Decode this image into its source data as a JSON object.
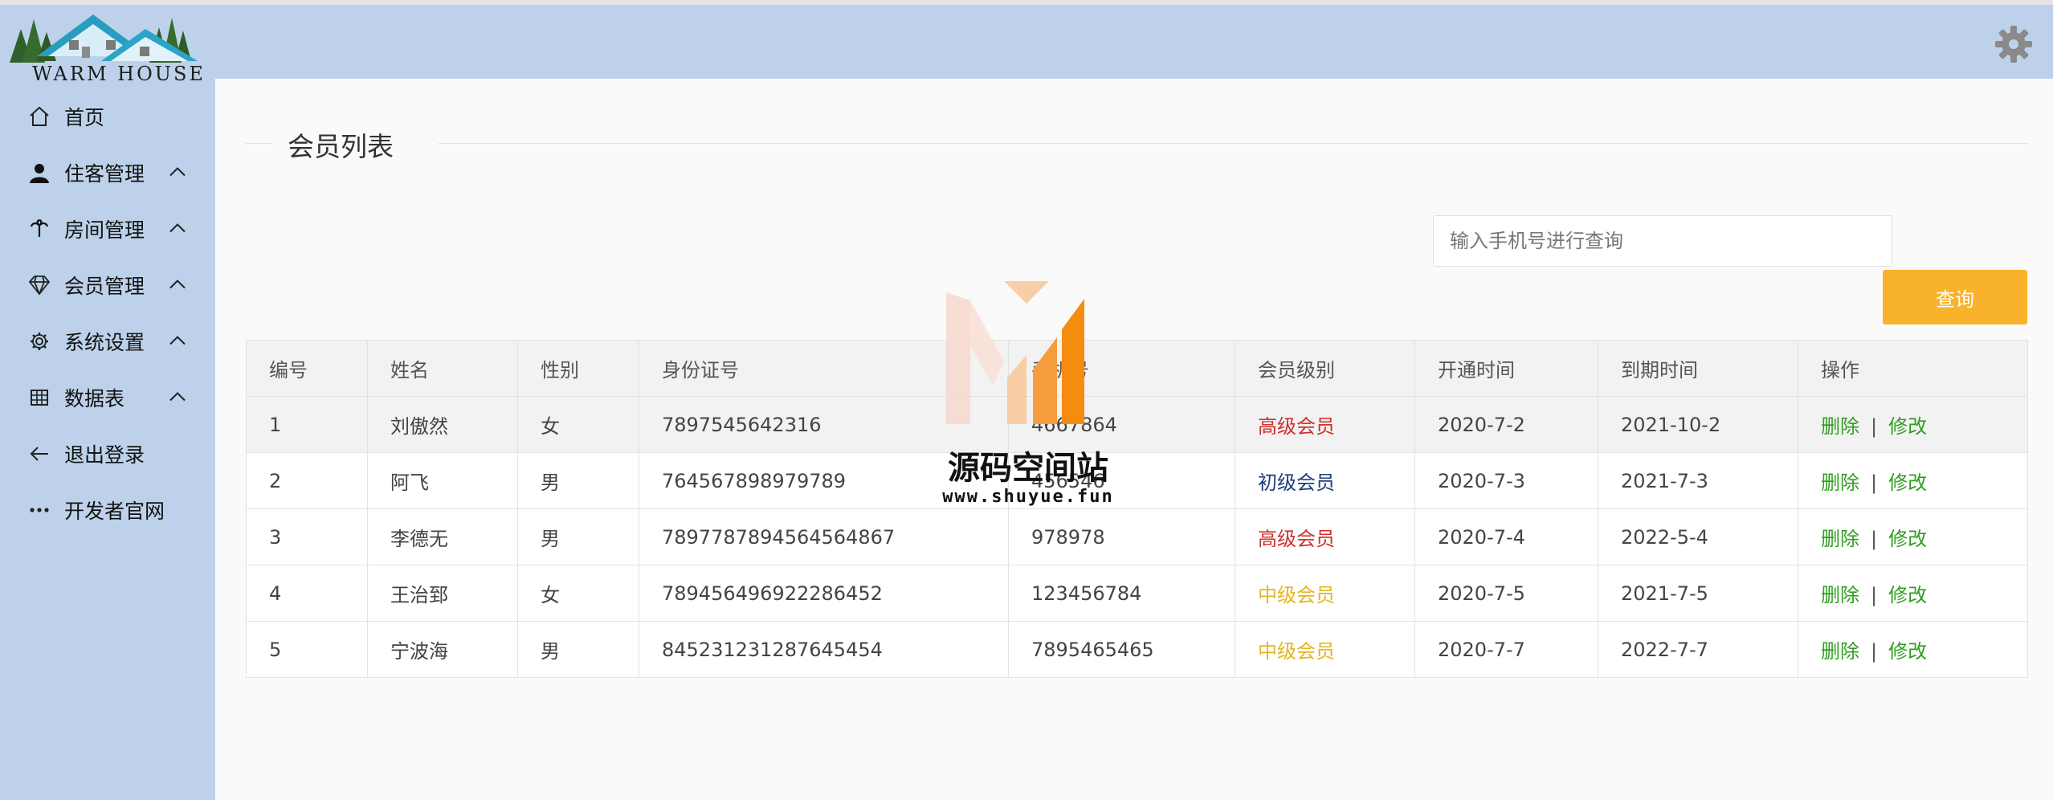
{
  "app": {
    "logo_text": "WARM HOUSE"
  },
  "sidebar": {
    "items": [
      {
        "label": "首页",
        "icon": "home-icon",
        "chevron": false
      },
      {
        "label": "住客管理",
        "icon": "user-icon",
        "chevron": true
      },
      {
        "label": "房间管理",
        "icon": "palm-tree-icon",
        "chevron": true
      },
      {
        "label": "会员管理",
        "icon": "diamond-icon",
        "chevron": true
      },
      {
        "label": "系统设置",
        "icon": "gear-icon",
        "chevron": true
      },
      {
        "label": "数据表",
        "icon": "grid-icon",
        "chevron": true
      },
      {
        "label": "退出登录",
        "icon": "arrow-left-icon",
        "chevron": false
      },
      {
        "label": "开发者官网",
        "icon": "ellipsis-icon",
        "chevron": false
      }
    ]
  },
  "header": {
    "settings_icon": "gear-icon"
  },
  "main": {
    "title": "会员列表",
    "search": {
      "placeholder": "输入手机号进行查询",
      "value": ""
    },
    "search_button": "查询",
    "table": {
      "columns": [
        "编号",
        "姓名",
        "性别",
        "身份证号",
        "手机号",
        "会员级别",
        "开通时间",
        "到期时间",
        "操作"
      ],
      "rows": [
        {
          "id": "1",
          "name": "刘傲然",
          "gender": "女",
          "id_card": "7897545642316",
          "phone": "4667864",
          "level": "高级会员",
          "level_color": "#d0312d",
          "start": "2020-7-2",
          "end": "2021-10-2"
        },
        {
          "id": "2",
          "name": "阿飞",
          "gender": "男",
          "id_card": "764567898979789",
          "phone": "456546",
          "level": "初级会员",
          "level_color": "#1f3f7a",
          "start": "2020-7-3",
          "end": "2021-7-3"
        },
        {
          "id": "3",
          "name": "李德无",
          "gender": "男",
          "id_card": "7897787894564564867",
          "phone": "978978",
          "level": "高级会员",
          "level_color": "#d0312d",
          "start": "2020-7-4",
          "end": "2022-5-4"
        },
        {
          "id": "4",
          "name": "王治郅",
          "gender": "女",
          "id_card": "789456496922286452",
          "phone": "123456784",
          "level": "中级会员",
          "level_color": "#e6b422",
          "start": "2020-7-5",
          "end": "2021-7-5"
        },
        {
          "id": "5",
          "name": "宁波海",
          "gender": "男",
          "id_card": "845231231287645454",
          "phone": "7895465465",
          "level": "中级会员",
          "level_color": "#e6b422",
          "start": "2020-7-7",
          "end": "2022-7-7"
        }
      ],
      "actions": {
        "delete": "删除",
        "separator": "|",
        "edit": "修改"
      }
    }
  },
  "watermark": {
    "title": "源码空间站",
    "url": "www.shuyue.fun"
  }
}
